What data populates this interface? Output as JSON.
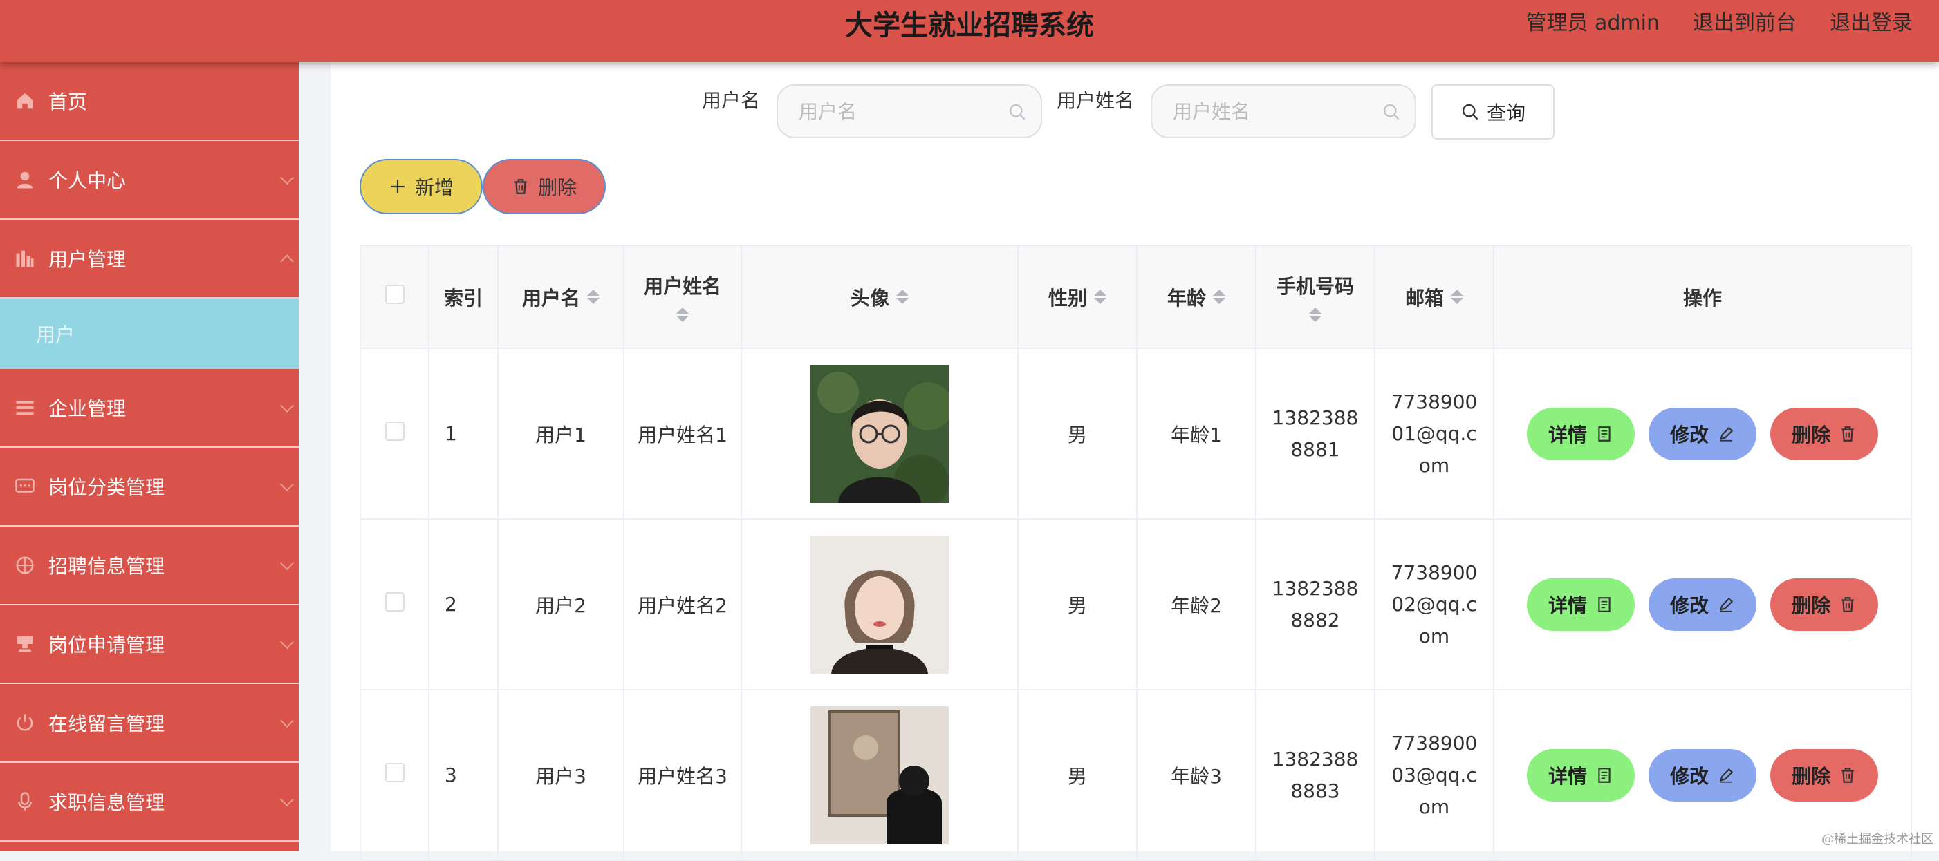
{
  "header": {
    "title": "大学生就业招聘系统",
    "admin_label": "管理员 admin",
    "front_label": "退出到前台",
    "logout_label": "退出登录"
  },
  "sidebar": {
    "items": [
      {
        "label": "首页",
        "icon": "home-icon"
      },
      {
        "label": "个人中心",
        "icon": "user-icon"
      },
      {
        "label": "用户管理",
        "icon": "chart-icon",
        "expanded": true
      },
      {
        "label": "企业管理",
        "icon": "list-icon"
      },
      {
        "label": "岗位分类管理",
        "icon": "message-icon"
      },
      {
        "label": "招聘信息管理",
        "icon": "compass-icon"
      },
      {
        "label": "岗位申请管理",
        "icon": "stamp-icon"
      },
      {
        "label": "在线留言管理",
        "icon": "power-icon"
      },
      {
        "label": "求职信息管理",
        "icon": "mic-icon"
      }
    ],
    "sub_item": "用户"
  },
  "search": {
    "username_label": "用户名",
    "username_placeholder": "用户名",
    "realname_label": "用户姓名",
    "realname_placeholder": "用户姓名",
    "query_label": "查询"
  },
  "actions": {
    "add_label": "新增",
    "delete_label": "删除"
  },
  "table": {
    "headers": {
      "index": "索引",
      "username": "用户名",
      "realname": "用户姓名",
      "avatar": "头像",
      "gender": "性别",
      "age": "年龄",
      "phone": "手机号码",
      "email": "邮箱",
      "ops": "操作"
    },
    "rows": [
      {
        "index": "1",
        "username": "用户1",
        "realname": "用户姓名1",
        "gender": "男",
        "age": "年龄1",
        "phone": "13823888881",
        "email": "773890001@qq.com"
      },
      {
        "index": "2",
        "username": "用户2",
        "realname": "用户姓名2",
        "gender": "男",
        "age": "年龄2",
        "phone": "13823888882",
        "email": "773890002@qq.com"
      },
      {
        "index": "3",
        "username": "用户3",
        "realname": "用户姓名3",
        "gender": "男",
        "age": "年龄3",
        "phone": "13823888883",
        "email": "773890003@qq.com"
      }
    ],
    "op_labels": {
      "detail": "详情",
      "edit": "修改",
      "delete": "删除"
    }
  },
  "watermark": "@稀土掘金技术社区"
}
